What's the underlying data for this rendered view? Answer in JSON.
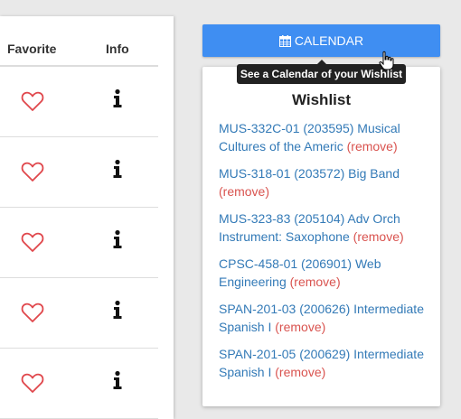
{
  "table": {
    "headers": {
      "favorite": "Favorite",
      "info": "Info"
    },
    "rows": [
      {
        "favorite": false
      },
      {
        "favorite": false
      },
      {
        "favorite": false
      },
      {
        "favorite": false
      },
      {
        "favorite": false
      }
    ]
  },
  "calendar_button": {
    "label": "CALENDAR",
    "icon": "calendar-icon"
  },
  "tooltip": {
    "text": "See a Calendar of your Wishlist"
  },
  "wishlist": {
    "title": "Wishlist",
    "remove_label": "(remove)",
    "items": [
      {
        "course": "MUS-332C-01 (203595) Musical Cultures of the Americ"
      },
      {
        "course": "MUS-318-01 (203572) Big Band"
      },
      {
        "course": "MUS-323-83 (205104) Adv Orch Instrument: Saxophone"
      },
      {
        "course": "CPSC-458-01 (206901) Web Engineering"
      },
      {
        "course": "SPAN-201-03 (200626) Intermediate Spanish I"
      },
      {
        "course": "SPAN-201-05 (200629) Intermediate Spanish I"
      }
    ]
  },
  "colors": {
    "accent": "#3f8ef2",
    "link": "#337ab7",
    "remove": "#d9534f",
    "heart": "#e0474c"
  }
}
